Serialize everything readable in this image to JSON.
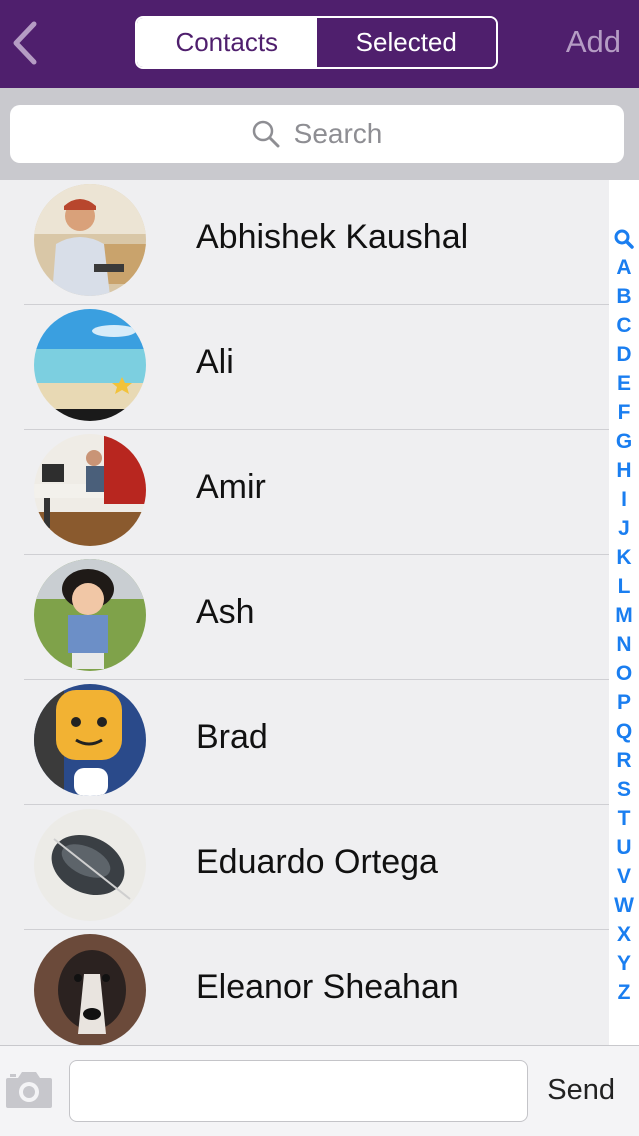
{
  "header": {
    "back_icon": "chevron-left-icon",
    "tabs": [
      {
        "label": "Contacts",
        "active": true
      },
      {
        "label": "Selected",
        "active": false
      }
    ],
    "add_label": "Add",
    "color": "#4f1f6d"
  },
  "search": {
    "placeholder": "Search",
    "icon": "search-icon"
  },
  "contacts": [
    {
      "name": "Abhishek Kaushal"
    },
    {
      "name": "Ali"
    },
    {
      "name": "Amir"
    },
    {
      "name": "Ash"
    },
    {
      "name": "Brad"
    },
    {
      "name": "Eduardo Ortega"
    },
    {
      "name": "Eleanor Sheahan"
    }
  ],
  "index": {
    "search_icon": "search-icon",
    "letters": [
      "A",
      "B",
      "C",
      "D",
      "E",
      "F",
      "G",
      "H",
      "I",
      "J",
      "K",
      "L",
      "M",
      "N",
      "O",
      "P",
      "Q",
      "R",
      "S",
      "T",
      "U",
      "V",
      "W",
      "X",
      "Y",
      "Z"
    ],
    "color": "#1a7ef0"
  },
  "composer": {
    "camera_icon": "camera-icon",
    "send_label": "Send"
  }
}
